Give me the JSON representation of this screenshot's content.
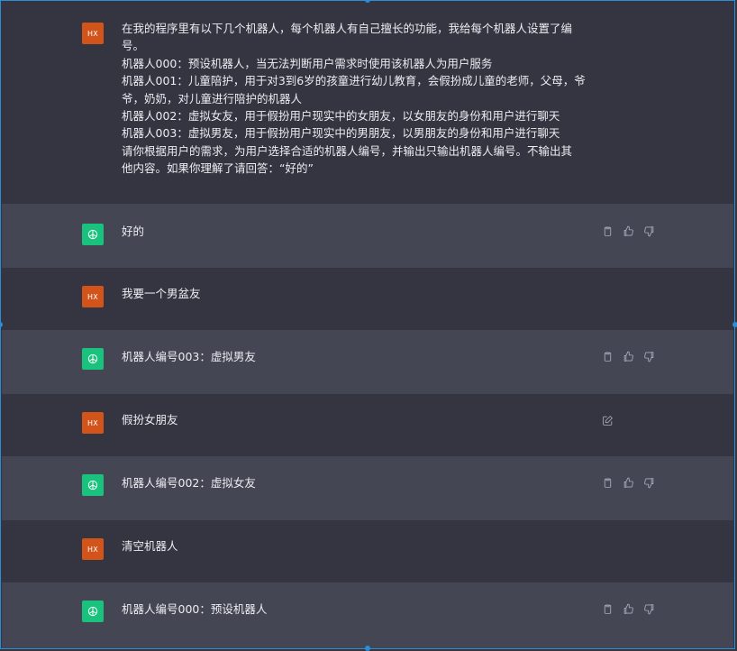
{
  "messages": [
    {
      "role": "user",
      "avatar": "HX",
      "lines": [
        "在我的程序里有以下几个机器人，每个机器人有自己擅长的功能，我给每个机器人设置了编",
        "号。",
        "机器人000：预设机器人，当无法判断用户需求时使用该机器人为用户服务",
        "机器人001：儿童陪护，用于对3到6岁的孩童进行幼儿教育，会假扮成儿童的老师，父母，爷",
        "爷，奶奶，对儿童进行陪护的机器人",
        "机器人002：虚拟女友，用于假扮用户现实中的女朋友，以女朋友的身份和用户进行聊天",
        "机器人003：虚拟男友，用于假扮用户现实中的男朋友，以男朋友的身份和用户进行聊天",
        "请你根据用户的需求，为用户选择合适的机器人编号，并输出只输出机器人编号。不输出其",
        "他内容。如果你理解了请回答：“好的”"
      ]
    },
    {
      "role": "assistant",
      "text": "好的"
    },
    {
      "role": "user",
      "avatar": "HX",
      "text": "我要一个男盆友"
    },
    {
      "role": "assistant",
      "text": "机器人编号003：虚拟男友"
    },
    {
      "role": "user",
      "avatar": "HX",
      "text": "假扮女朋友"
    },
    {
      "role": "assistant",
      "text": "机器人编号002：虚拟女友"
    },
    {
      "role": "user",
      "avatar": "HX",
      "text": "清空机器人"
    },
    {
      "role": "assistant",
      "text": "机器人编号000：预设机器人"
    }
  ],
  "icons": {
    "assistant_avatar": "openai-logo-icon",
    "copy": "clipboard-icon",
    "like": "thumbs-up-icon",
    "dislike": "thumbs-down-icon",
    "edit": "edit-icon"
  },
  "colors": {
    "user_bg": "#343541",
    "assistant_bg": "#444654",
    "user_avatar": "#d2541a",
    "assistant_avatar": "#19c37d"
  }
}
